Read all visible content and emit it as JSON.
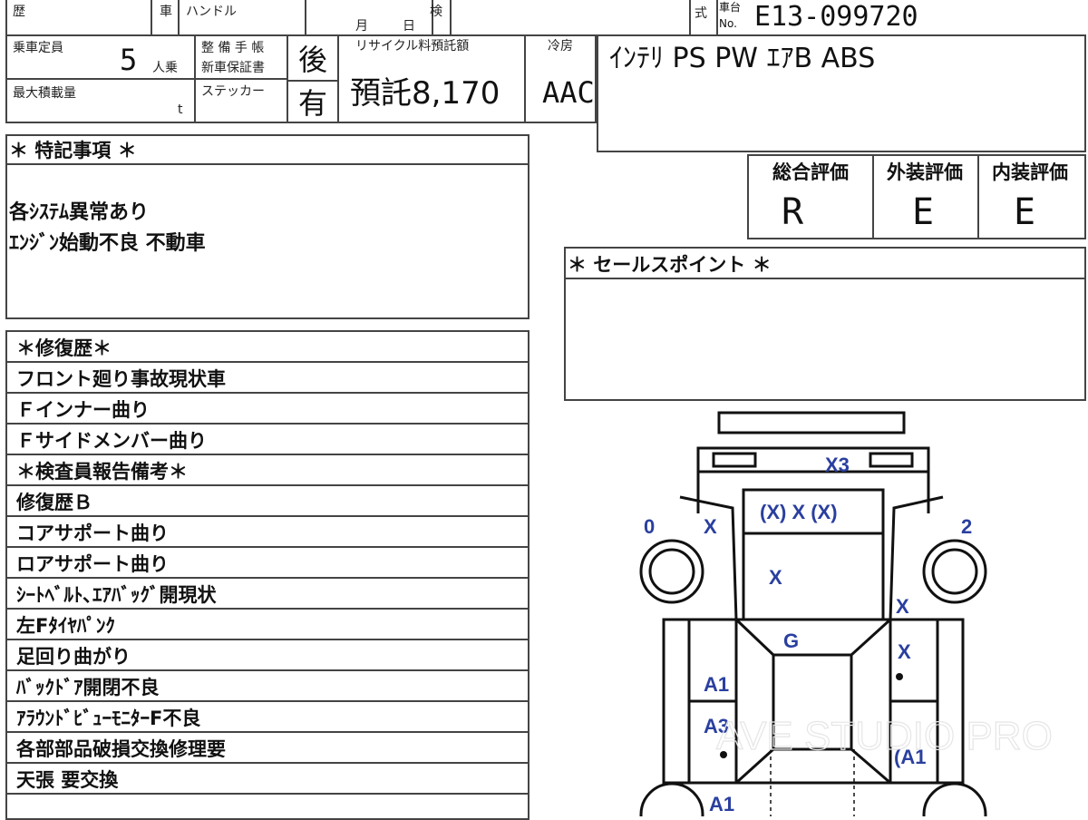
{
  "header": {
    "reki_label": "歴",
    "sha_label": "車",
    "handle_label": "ハンドル",
    "tsuki_label": "月",
    "hi_label": "日",
    "ken_label": "検",
    "shiki_label": "式",
    "chassis_label_top": "車台",
    "chassis_label_no": "No.",
    "chassis_no": "E13-099720"
  },
  "specs": {
    "capacity_label": "乗車定員",
    "capacity_value": "5",
    "capacity_unit": "人乗",
    "max_load_label": "最大積載量",
    "max_load_unit": "t",
    "maintenance_label_1": "整 備 手 帳",
    "maintenance_label_2": "新車保証書",
    "sticker_label": "ステッカー",
    "maintenance_value": "後",
    "sticker_value": "有",
    "recycle_label": "リサイクル料預託額",
    "recycle_value": "預託8,170",
    "cooler_label": "冷房",
    "cooler_value": "AAC",
    "equipment": "ｲﾝﾃﾘ PS PW ｴｱB ABS"
  },
  "remarks": {
    "title": "＊ 特記事項 ＊",
    "lines": [
      "各ｼｽﾃﾑ異常あり",
      "ｴﾝｼﾞﾝ始動不良 不動車"
    ]
  },
  "ratings": {
    "overall_label": "総合評価",
    "overall_value": "R",
    "exterior_label": "外装評価",
    "exterior_value": "E",
    "interior_label": "内装評価",
    "interior_value": "E"
  },
  "sales_points": {
    "title": "＊ セールスポイント ＊"
  },
  "repair": {
    "rows": [
      "＊修復歴＊",
      "フロント廻り事故現状車",
      "Ｆインナー曲り",
      "Ｆサイドメンバー曲り",
      "＊検査員報告備考＊",
      "修復歴Ｂ",
      "コアサポート曲り",
      "ロアサポート曲り",
      "ｼｰﾄﾍﾞﾙﾄ､ｴｱﾊﾞｯｸﾞ開現状",
      "左Fﾀｲﾔﾊﾟﾝｸ",
      "足回り曲がり",
      "ﾊﾞｯｸﾄﾞｱ開閉不良",
      "ｱﾗｳﾝﾄﾞﾋﾞｭｰﾓﾆﾀｰF不良",
      "各部部品破損交換修理要",
      "天張 要交換"
    ]
  },
  "diagram": {
    "marks": {
      "front_bumper": "X3",
      "hood_top": "(X) X (X)",
      "left_front_tire": "0",
      "right_front_tire": "2",
      "left_fender": "X",
      "hood_center": "X",
      "right_fender": "X",
      "roof": "G",
      "right_front_door": "X",
      "left_front_door": "A1",
      "left_rear_door": "A3",
      "right_rear_door": "(A1",
      "left_rear_fender": "A1"
    }
  },
  "watermark": "AVE STUDIO PRO"
}
